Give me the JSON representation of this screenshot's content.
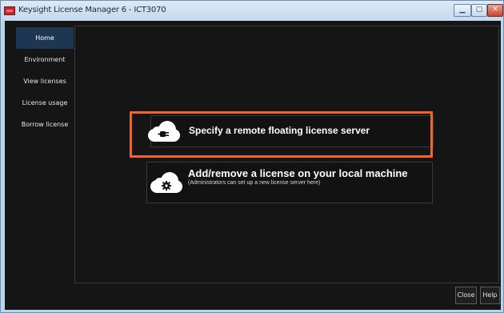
{
  "window": {
    "title": "Keysight License Manager 6 - ICT3070",
    "minimize_symbol": "▁",
    "maximize_symbol": "▢",
    "close_symbol": "✕"
  },
  "sidebar": {
    "items": [
      {
        "label": "Home",
        "active": true
      },
      {
        "label": "Environment",
        "active": false
      },
      {
        "label": "View licenses",
        "active": false
      },
      {
        "label": "License usage",
        "active": false
      },
      {
        "label": "Borrow license",
        "active": false
      }
    ]
  },
  "main": {
    "options": [
      {
        "title": "Specify a remote floating license server",
        "icon": "cloud-plug-icon"
      },
      {
        "title": "Add/remove a license on your local machine",
        "subtitle": "(Administrators can set up a new license server here)",
        "icon": "cloud-gear-icon"
      }
    ],
    "highlight_color": "#f06529"
  },
  "footer": {
    "close_label": "Close",
    "help_label": "Help"
  },
  "colors": {
    "background": "#151515",
    "sidebar_active": "#1d3752",
    "text": "#ffffff"
  }
}
